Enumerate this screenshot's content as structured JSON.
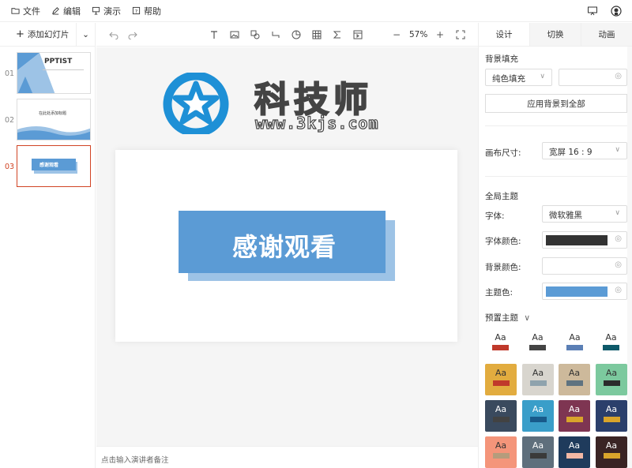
{
  "menu": {
    "items": [
      {
        "label": "文件",
        "icon": "folder-icon"
      },
      {
        "label": "编辑",
        "icon": "edit-icon"
      },
      {
        "label": "演示",
        "icon": "present-icon"
      },
      {
        "label": "帮助",
        "icon": "help-icon"
      }
    ]
  },
  "sidebar": {
    "add_slide_label": "添加幻灯片",
    "slides": [
      {
        "num": "01",
        "title": "PPTIST"
      },
      {
        "num": "02",
        "title": "在此处添加标题"
      },
      {
        "num": "03",
        "title": "感谢观看"
      }
    ]
  },
  "toolbar": {
    "zoom": "57%"
  },
  "watermark": {
    "title": "科技师",
    "url": "www.3kjs.com"
  },
  "slide": {
    "text": "感谢观看"
  },
  "notes": {
    "placeholder": "点击输入演讲者备注"
  },
  "panel": {
    "tabs": [
      "设计",
      "切换",
      "动画"
    ],
    "bg_fill_label": "背景填充",
    "bg_fill_type": "纯色填充",
    "apply_all": "应用背景到全部",
    "canvas_size_label": "画布尺寸:",
    "canvas_size_value": "宽屏 16 : 9",
    "global_theme": "全局主题",
    "font_label": "字体:",
    "font_value": "微软雅黑",
    "font_color_label": "字体颜色:",
    "bg_color_label": "背景颜色:",
    "theme_color_label": "主题色:",
    "preset_label": "预置主题",
    "aa": "Aa",
    "colors": {
      "font": "#333333",
      "bg": "#ffffff",
      "theme": "#5b9bd5"
    },
    "presets_light": [
      {
        "bar": "#c0392b"
      },
      {
        "bar": "#444444"
      },
      {
        "bar": "#5b7fb5"
      },
      {
        "bar": "#0e5a6a"
      }
    ],
    "presets_cards": [
      {
        "bg": "#e2ac3f",
        "text": "#333",
        "bar": "#c0392b"
      },
      {
        "bg": "#d8d5ce",
        "text": "#333",
        "bar": "#8fa3ad"
      },
      {
        "bg": "#cdb99b",
        "text": "#333",
        "bar": "#5f7380"
      },
      {
        "bg": "#7cc99e",
        "text": "#333",
        "bar": "#2b2b2b"
      },
      {
        "bg": "#3a4a5e",
        "text": "#fff",
        "bar": "#424242"
      },
      {
        "bg": "#3a9ec9",
        "text": "#fff",
        "bar": "#185a8a"
      },
      {
        "bg": "#7e3552",
        "text": "#fff",
        "bar": "#d9a42b"
      },
      {
        "bg": "#2b3f6b",
        "text": "#fff",
        "bar": "#d9a42b"
      },
      {
        "bg": "#f4957a",
        "text": "#333",
        "bar": "#b59c7c"
      },
      {
        "bg": "#5f6f7c",
        "text": "#fff",
        "bar": "#3a3a3a"
      },
      {
        "bg": "#1f3b5c",
        "text": "#fff",
        "bar": "#f3b8a5"
      },
      {
        "bg": "#3a2424",
        "text": "#fff",
        "bar": "#d9a42b"
      }
    ]
  }
}
